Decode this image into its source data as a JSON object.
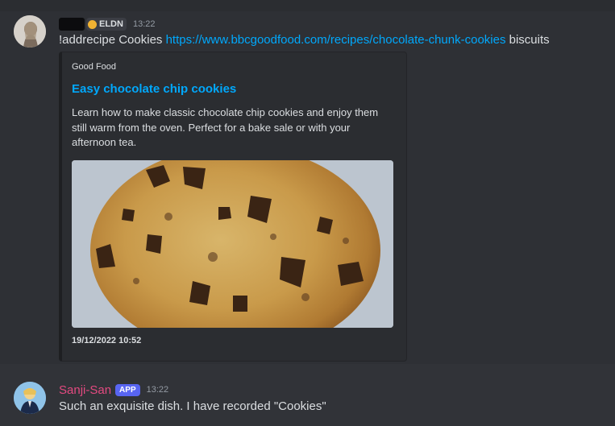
{
  "message1": {
    "author_redacted": true,
    "role_tag": "ELDN",
    "timestamp": "13:22",
    "text_before": "!addrecipe Cookies ",
    "link": "https://www.bbcgoodfood.com/recipes/chocolate-chunk-cookies",
    "text_after": " biscuits",
    "embed": {
      "provider": "Good Food",
      "title": "Easy chocolate chip cookies",
      "description": "Learn how to make classic chocolate chip cookies and enjoy them still warm from the oven. Perfect for a bake sale or with your afternoon tea.",
      "image_alt": "chocolate chip cookie",
      "footer": "19/12/2022 10:52"
    }
  },
  "message2": {
    "author": "Sanji-San",
    "badge": "APP",
    "timestamp": "13:22",
    "text": "Such an exquisite dish. I have recorded \"Cookies\""
  },
  "colors": {
    "background": "#313338",
    "link": "#00a8fc",
    "author2": "#e34a80",
    "app_badge": "#5865f2"
  }
}
